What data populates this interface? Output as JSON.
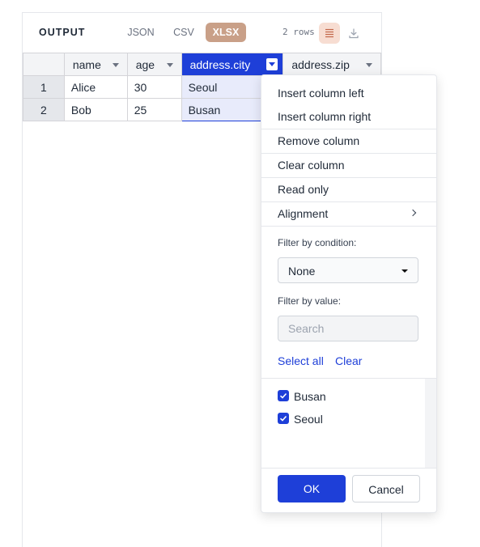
{
  "output": {
    "title": "OUTPUT",
    "formats": [
      "JSON",
      "CSV",
      "XLSX"
    ],
    "active_format": "XLSX",
    "rows_label": "2 rows",
    "icons": [
      "wrap-text-icon",
      "download-icon"
    ]
  },
  "table": {
    "columns": [
      "name",
      "age",
      "address.city",
      "address.zip"
    ],
    "selected_column": "address.city",
    "rows": [
      {
        "index": "1",
        "cells": [
          "Alice",
          "30",
          "Seoul"
        ]
      },
      {
        "index": "2",
        "cells": [
          "Bob",
          "25",
          "Busan"
        ]
      }
    ]
  },
  "menu": {
    "items": [
      "Insert column left",
      "Insert column right",
      "Remove column",
      "Clear column",
      "Read only",
      "Alignment"
    ],
    "filter_condition_label": "Filter by condition:",
    "condition_value": "None",
    "filter_value_label": "Filter by value:",
    "search_placeholder": "Search",
    "select_all": "Select all",
    "clear": "Clear",
    "values": [
      {
        "label": "Busan",
        "checked": true
      },
      {
        "label": "Seoul",
        "checked": true
      }
    ],
    "ok": "OK",
    "cancel": "Cancel"
  },
  "colors": {
    "accent": "#1e3fd8",
    "active_format": "#c9a088"
  }
}
